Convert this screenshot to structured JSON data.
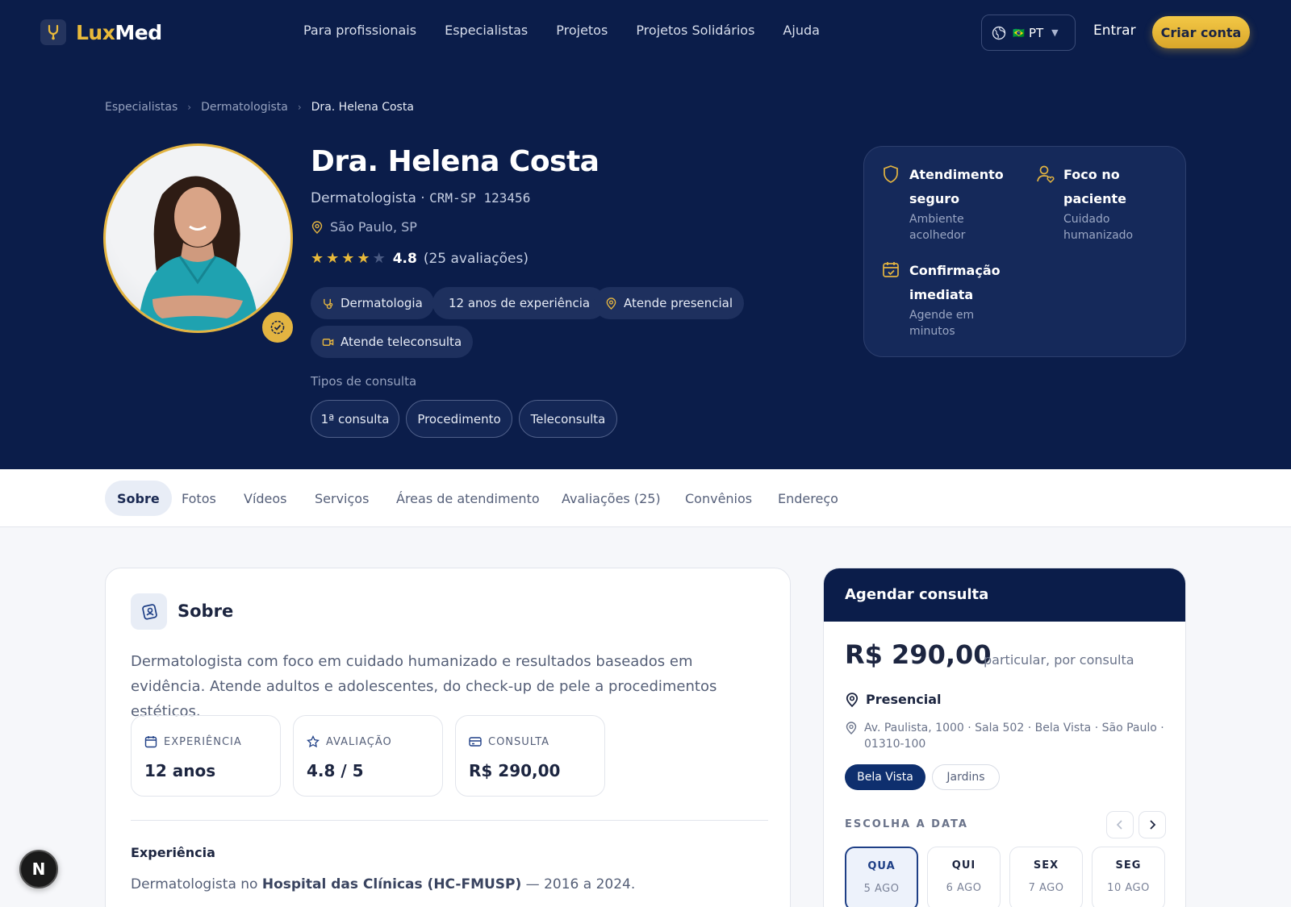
{
  "brand": {
    "name_part1": "Lux",
    "name_part2": "Med",
    "accent": "#e8b93a",
    "navy": "#0b1d4a"
  },
  "nav": {
    "links": [
      "Para profissionais",
      "Especialistas",
      "Projetos",
      "Projetos Solidários",
      "Ajuda"
    ],
    "language": {
      "flag": "🇧🇷",
      "code": "PT"
    },
    "signin": "Entrar",
    "signup": "Criar conta"
  },
  "breadcrumb": [
    "Especialistas",
    "Dermatologista",
    "Dra. Helena Costa"
  ],
  "doctor": {
    "name": "Dra. Helena Costa",
    "specialty": "Dermatologista",
    "sep": "·",
    "crm": "CRM-SP 123456",
    "location": "São Paulo, SP",
    "rating": {
      "score": "4.8",
      "count": "(25 avaliações)",
      "stars_filled": 4,
      "stars_total": 5
    },
    "chips": [
      "Dermatologia",
      "12 anos de experiência",
      "Atende presencial",
      "Atende teleconsulta"
    ],
    "consult_types_label": "Tipos de consulta",
    "consult_types": [
      "1ª consulta",
      "Procedimento",
      "Teleconsulta"
    ]
  },
  "features": [
    {
      "icon": "shield-icon",
      "title_1": "Atendimento",
      "title_2": "seguro",
      "desc_1": "Ambiente",
      "desc_2": "acolhedor"
    },
    {
      "icon": "user-heart-icon",
      "title_1": "Foco no",
      "title_2": "paciente",
      "desc_1": "Cuidado",
      "desc_2": "humanizado"
    },
    {
      "icon": "calendar-check-icon",
      "title_1": "Confirmação",
      "title_2": "imediata",
      "desc_1": "Agende em",
      "desc_2": "minutos"
    }
  ],
  "tabs": [
    "Sobre",
    "Fotos",
    "Vídeos",
    "Serviços",
    "Áreas de atendimento",
    "Avaliações (25)",
    "Convênios",
    "Endereço"
  ],
  "about": {
    "title": "Sobre",
    "text": "Dermatologista com foco em cuidado humanizado e resultados baseados em evidência. Atende adultos e adolescentes, do check-up de pele a procedimentos estéticos.",
    "stats": [
      {
        "icon": "calendar-icon",
        "label": "EXPERIÊNCIA",
        "value": "12 anos"
      },
      {
        "icon": "star-icon",
        "label": "AVALIAÇÃO",
        "value": "4.8 / 5"
      },
      {
        "icon": "card-icon",
        "label": "CONSULTA",
        "value": "R$ 290,00"
      }
    ],
    "experience_title": "Experiência",
    "experience_pre": "Dermatologista no ",
    "experience_bold": "Hospital das Clínicas (HC-FMUSP)",
    "experience_post": " — 2016 a 2024."
  },
  "booking": {
    "title": "Agendar consulta",
    "price": "R$ 290,00",
    "price_sub": "particular, por consulta",
    "modality": "Presencial",
    "address": "Av. Paulista, 1000 · Sala 502 · Bela Vista · São Paulo · 01310-100",
    "neighborhoods": [
      "Bela Vista",
      "Jardins"
    ],
    "date_label": "ESCOLHA A DATA",
    "days": [
      {
        "weekday": "QUA",
        "date": "5 AGO",
        "selected": true
      },
      {
        "weekday": "QUI",
        "date": "6 AGO",
        "selected": false
      },
      {
        "weekday": "SEX",
        "date": "7 AGO",
        "selected": false
      },
      {
        "weekday": "SEG",
        "date": "10 AGO",
        "selected": false
      }
    ]
  },
  "dev_badge": "N"
}
